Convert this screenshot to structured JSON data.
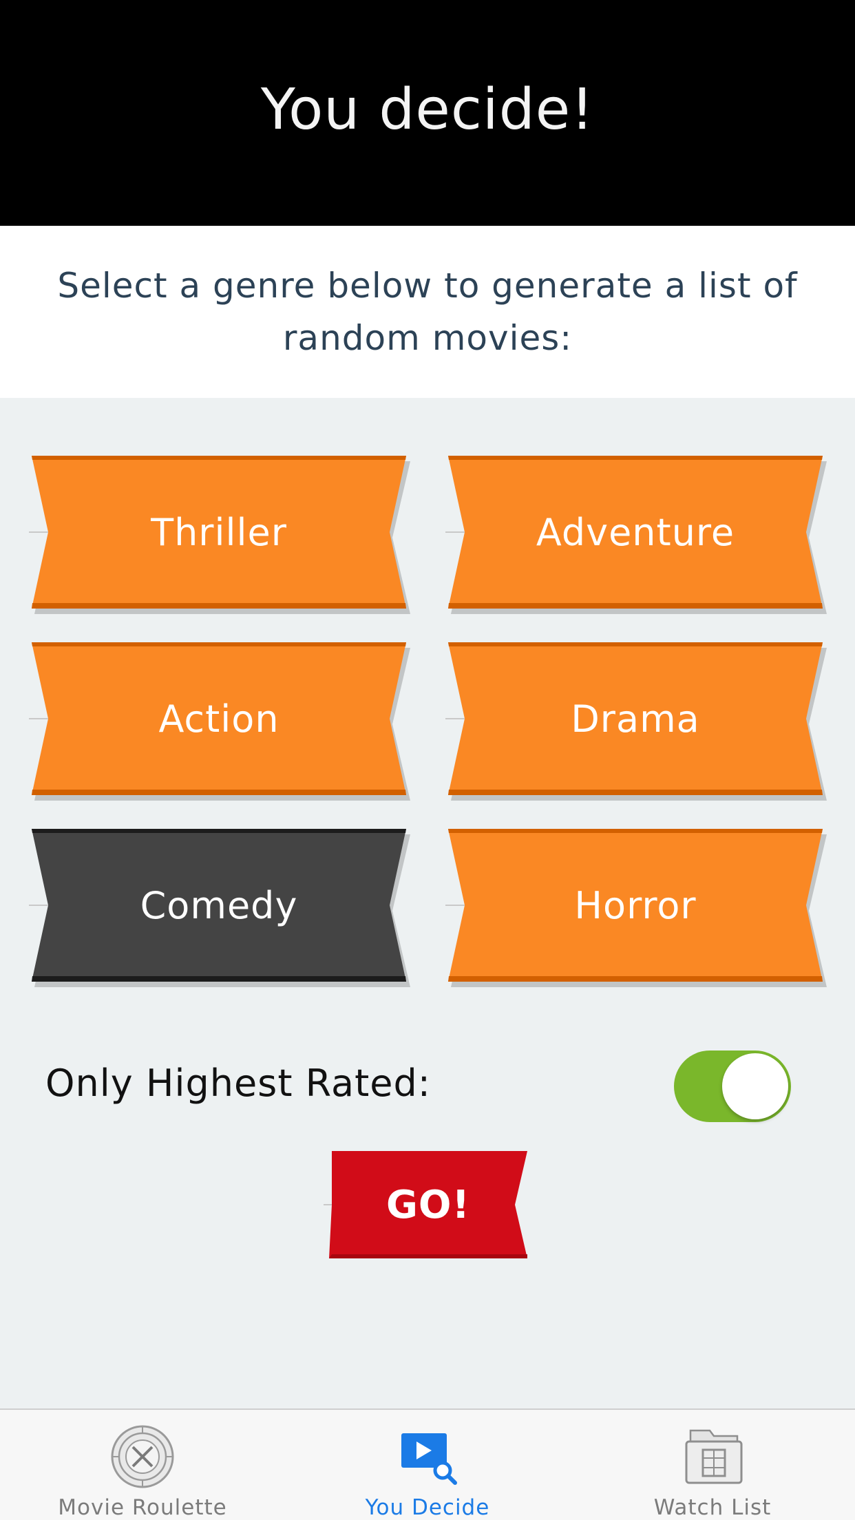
{
  "header": {
    "title": "You decide!"
  },
  "instructions": {
    "text": "Select a genre below to generate a list of random movies:"
  },
  "colors": {
    "genre_default": "#fa8824",
    "genre_selected": "#444444",
    "go": "#d10c18",
    "toggle_on": "#7ab72b",
    "tab_active": "#1b7be6"
  },
  "genres": [
    {
      "label": "Thriller",
      "selected": false
    },
    {
      "label": "Adventure",
      "selected": false
    },
    {
      "label": "Action",
      "selected": false
    },
    {
      "label": "Drama",
      "selected": false
    },
    {
      "label": "Comedy",
      "selected": true
    },
    {
      "label": "Horror",
      "selected": false
    }
  ],
  "filter": {
    "label": "Only Highest Rated:",
    "enabled": true
  },
  "go_button": {
    "label": "GO!"
  },
  "tabbar": {
    "tabs": [
      {
        "label": "Movie Roulette",
        "icon": "roulette-icon",
        "active": false
      },
      {
        "label": "You Decide",
        "icon": "play-search-icon",
        "active": true
      },
      {
        "label": "Watch List",
        "icon": "film-folder-icon",
        "active": false
      }
    ]
  }
}
